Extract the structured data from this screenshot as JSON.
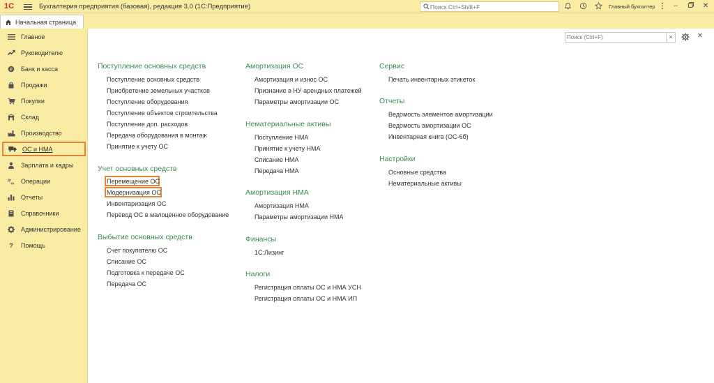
{
  "titlebar": {
    "logo": "1С",
    "app_title": "Бухгалтерия предприятия (базовая), редакция 3.0  (1С:Предприятие)",
    "search_placeholder": "Поиск Ctrl+Shift+F",
    "user_name": "Главный бухгалтер"
  },
  "tabs": {
    "home_label": "Начальная страница"
  },
  "sidebar": {
    "items": [
      {
        "label": "Главное",
        "icon": "list-icon"
      },
      {
        "label": "Руководителю",
        "icon": "trend-icon"
      },
      {
        "label": "Банк и касса",
        "icon": "coin-icon"
      },
      {
        "label": "Продажи",
        "icon": "bag-icon"
      },
      {
        "label": "Покупки",
        "icon": "cart-icon"
      },
      {
        "label": "Склад",
        "icon": "warehouse-icon"
      },
      {
        "label": "Производство",
        "icon": "factory-icon"
      },
      {
        "label": "ОС и НМА",
        "icon": "truck-icon"
      },
      {
        "label": "Зарплата и кадры",
        "icon": "person-icon"
      },
      {
        "label": "Операции",
        "icon": "dt-kt-icon"
      },
      {
        "label": "Отчеты",
        "icon": "bar-chart-icon"
      },
      {
        "label": "Справочники",
        "icon": "book-icon"
      },
      {
        "label": "Администрирование",
        "icon": "gear-icon"
      },
      {
        "label": "Помощь",
        "icon": "question-icon"
      }
    ]
  },
  "content": {
    "search_placeholder": "Поиск (Ctrl+F)",
    "groups": {
      "col1": [
        {
          "title": "Поступление основных средств",
          "links": [
            "Поступление основных средств",
            "Приобретение земельных участков",
            "Поступление оборудования",
            "Поступление объектов строительства",
            "Поступление доп. расходов",
            "Передача оборудования в монтаж",
            "Принятие к учету ОС"
          ]
        },
        {
          "title": "Учет основных средств",
          "links": [
            "Перемещение ОС",
            "Модернизация ОС",
            "Инвентаризация ОС",
            "Перевод ОС в малоценное оборудование"
          ]
        },
        {
          "title": "Выбытие основных средств",
          "links": [
            "Счет покупателю ОС",
            "Списание ОС",
            "Подготовка к передаче ОС",
            "Передача ОС"
          ]
        }
      ],
      "col2": [
        {
          "title": "Амортизация ОС",
          "links": [
            "Амортизация и износ ОС",
            "Признание в НУ арендных платежей",
            "Параметры амортизации ОС"
          ]
        },
        {
          "title": "Нематериальные активы",
          "links": [
            "Поступление НМА",
            "Принятие к учету НМА",
            "Списание НМА",
            "Передача НМА"
          ]
        },
        {
          "title": "Амортизация НМА",
          "links": [
            "Амортизация НМА",
            "Параметры амортизации НМА"
          ]
        },
        {
          "title": "Финансы",
          "links": [
            "1С:Лизинг"
          ]
        },
        {
          "title": "Налоги",
          "links": [
            "Регистрация оплаты ОС и НМА УСН",
            "Регистрация оплаты ОС и НМА ИП"
          ]
        }
      ],
      "col3": [
        {
          "title": "Сервис",
          "links": [
            "Печать инвентарных этикеток"
          ]
        },
        {
          "title": "Отчеты",
          "links": [
            "Ведомость элементов амортизации",
            "Ведомость амортизации ОС",
            "Инвентарная книга (ОС-6б)"
          ]
        },
        {
          "title": "Настройки",
          "links": [
            "Основные средства",
            "Нематериальные активы"
          ]
        }
      ]
    }
  }
}
